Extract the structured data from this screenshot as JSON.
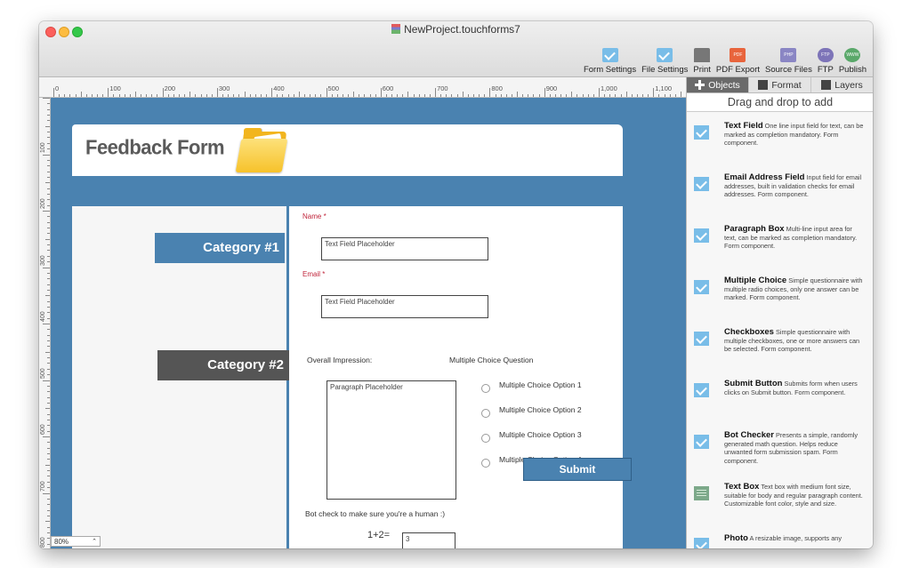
{
  "window": {
    "title": "NewProject.touchforms7"
  },
  "toolbar": {
    "items": [
      {
        "label": "Form Settings",
        "icon": "check-icon"
      },
      {
        "label": "File Settings",
        "icon": "check-icon"
      },
      {
        "label": "Print",
        "icon": "printer-icon"
      },
      {
        "label": "PDF Export",
        "icon": "pdf-icon",
        "icon_text": "PDF"
      },
      {
        "label": "Source Files",
        "icon": "php-icon",
        "icon_text": "PHP"
      },
      {
        "label": "FTP",
        "icon": "ftp-icon",
        "icon_text": "FTP"
      },
      {
        "label": "Publish",
        "icon": "globe-icon",
        "icon_text": "WWW"
      }
    ]
  },
  "ruler": {
    "labels": [
      "0",
      "100",
      "200",
      "300",
      "400",
      "500",
      "600",
      "700",
      "800",
      "900",
      "1,000",
      "1,100"
    ],
    "vlabels": [
      "100",
      "200",
      "300",
      "400",
      "500",
      "600",
      "700",
      "800"
    ]
  },
  "form": {
    "title": "Feedback Form",
    "category1": "Category #1",
    "category2": "Category #2",
    "name_label": "Name *",
    "name_placeholder": "Text Field Placeholder",
    "email_label": "Email *",
    "email_placeholder": "Text Field Placeholder",
    "overall_label": "Overall Impression:",
    "mc_label": "Multiple Choice Question",
    "paragraph_placeholder": "Paragraph Placeholder",
    "mc_options": [
      "Multiple Choice Option 1",
      "Multiple Choice Option 2",
      "Multiple Choice Option 3",
      "Multiple Choice Option 4"
    ],
    "bot_label": "Bot check to make sure you're a human :)",
    "bot_question": "1+2=",
    "bot_answer": "3",
    "submit_label": "Submit"
  },
  "zoom": {
    "value": "80%"
  },
  "sidebar": {
    "tabs": [
      {
        "label": "Objects",
        "active": true
      },
      {
        "label": "Format",
        "active": false
      },
      {
        "label": "Layers",
        "active": false
      }
    ],
    "header": "Drag and drop to add",
    "objects": [
      {
        "name": "Text Field",
        "desc": "One line input field for text, can be marked as completion mandatory.  Form component.",
        "icon": "check-icon"
      },
      {
        "name": "Email Address Field",
        "desc": "Input field for email addresses, built in validation checks for email addresses.  Form component.",
        "icon": "check-icon"
      },
      {
        "name": "Paragraph Box",
        "desc": "Multi-line input area for text, can be marked as completion mandatory.  Form component.",
        "icon": "check-icon"
      },
      {
        "name": "Multiple Choice",
        "desc": "Simple questionnaire with multiple radio choices, only one answer can be marked.  Form component.",
        "icon": "check-icon"
      },
      {
        "name": "Checkboxes",
        "desc": "Simple questionnaire with multiple checkboxes, one or more answers can be selected.  Form component.",
        "icon": "check-icon"
      },
      {
        "name": "Submit Button",
        "desc": "Submits form when users clicks on Submit button.  Form component.",
        "icon": "check-icon"
      },
      {
        "name": "Bot Checker",
        "desc": "Presents a simple, randomly generated math question.  Helps reduce unwanted form submission spam. Form component.",
        "icon": "check-icon"
      },
      {
        "name": "Text Box",
        "desc": "Text box with medium font size, suitable for body and regular paragraph content. Customizable font color, style and size.",
        "icon": "textbox-icon"
      },
      {
        "name": "Photo",
        "desc": "A resizable image, supports any",
        "icon": "photo-icon"
      }
    ]
  }
}
